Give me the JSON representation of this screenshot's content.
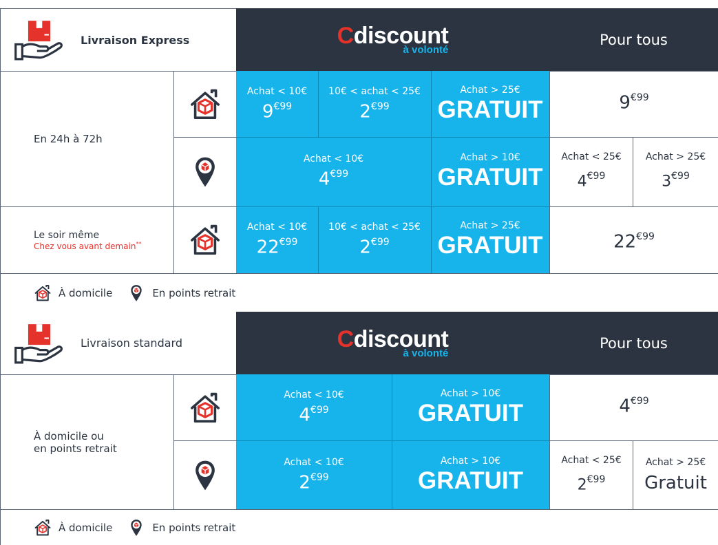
{
  "express": {
    "title": "Livraison Express",
    "brand_c": "C",
    "brand_rest": "discount",
    "brand_sub": "à volonté",
    "pour_tous": "Pour tous",
    "row1_label": "En 24h à 72h",
    "row1_home": {
      "c1_label": "Achat < 10€",
      "c1_int": "9",
      "c1_dec": "€99",
      "c2_label": "10€ < achat < 25€",
      "c2_int": "2",
      "c2_dec": "€99",
      "c3_label": "Achat > 25€",
      "c3_big": "GRATUIT",
      "all_int": "9",
      "all_dec": "€99"
    },
    "row1_relay": {
      "c1_label": "Achat < 10€",
      "c1_int": "4",
      "c1_dec": "€99",
      "c3_label": "Achat > 10€",
      "c3_big": "GRATUIT",
      "a_label": "Achat < 25€",
      "a_int": "4",
      "a_dec": "€99",
      "b_label": "Achat > 25€",
      "b_int": "3",
      "b_dec": "€99"
    },
    "row2_label": "Le soir même",
    "row2_sub": "Chez vous avant demain",
    "row2_sub_mark": "**",
    "row2_home": {
      "c1_label": "Achat < 10€",
      "c1_int": "22",
      "c1_dec": "€99",
      "c2_label": "10€ < achat < 25€",
      "c2_int": "2",
      "c2_dec": "€99",
      "c3_label": "Achat > 25€",
      "c3_big": "GRATUIT",
      "all_int": "22",
      "all_dec": "€99"
    }
  },
  "legend": {
    "home": "À domicile",
    "relay": "En points retrait"
  },
  "standard": {
    "title": "Livraison standard",
    "brand_c": "C",
    "brand_rest": "discount",
    "brand_sub": "à volonté",
    "pour_tous": "Pour tous",
    "row_label_1": "À domicile ou",
    "row_label_2": "en points retrait",
    "home": {
      "c1_label": "Achat < 10€",
      "c1_int": "4",
      "c1_dec": "€99",
      "c2_label": "Achat > 10€",
      "c2_big": "GRATUIT",
      "all_int": "4",
      "all_dec": "€99"
    },
    "relay": {
      "c1_label": "Achat < 10€",
      "c1_int": "2",
      "c1_dec": "€99",
      "c2_label": "Achat > 10€",
      "c2_big": "GRATUIT",
      "a_label": "Achat < 25€",
      "a_int": "2",
      "a_dec": "€99",
      "b_label": "Achat > 25€",
      "b_text": "Gratuit"
    }
  },
  "colors": {
    "blue": "#17b3eb",
    "dark": "#2b3440",
    "red": "#e5322b"
  },
  "icons": {
    "header": "hand-box-icon",
    "home": "home-box-icon",
    "relay": "map-pin-box-icon"
  }
}
